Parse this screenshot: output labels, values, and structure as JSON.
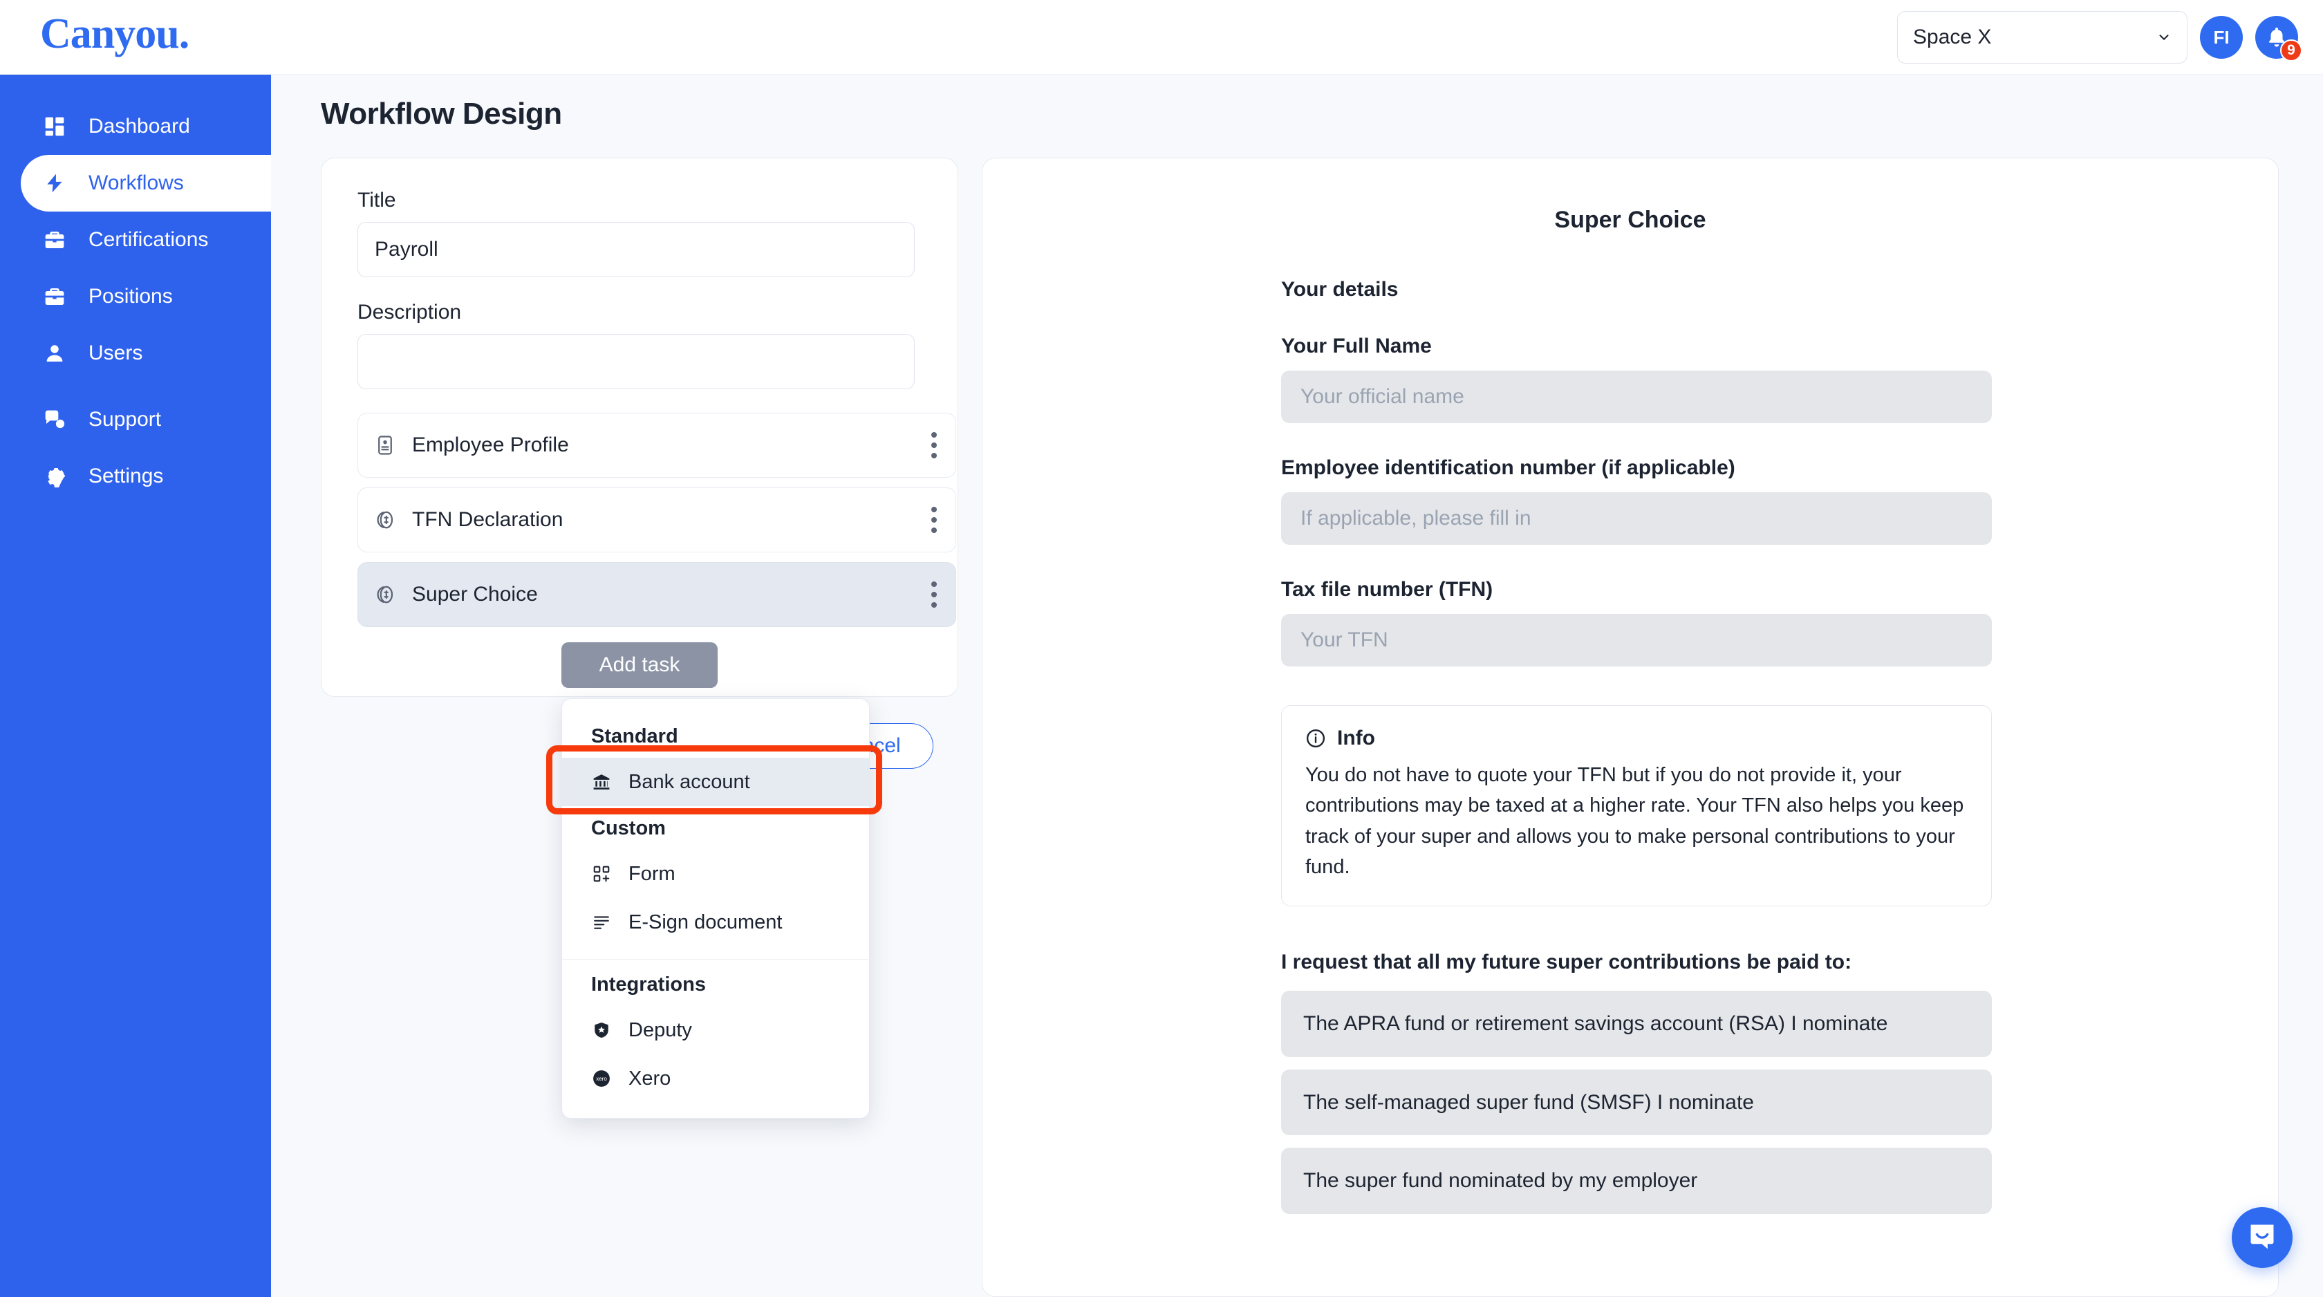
{
  "brand": {
    "logo_text": "Canyou.",
    "accent_color": "#2f6bf0",
    "sidebar_color": "#2f62ec"
  },
  "header": {
    "space_selector": {
      "value": "Space X",
      "icon": "chevron-down-icon"
    },
    "avatar_initials": "FI",
    "notification": {
      "icon": "bell-icon",
      "badge_count": "9",
      "badge_color": "#ef3a17"
    }
  },
  "sidebar": {
    "items": [
      {
        "label": "Dashboard",
        "icon": "dashboard-icon",
        "active": false
      },
      {
        "label": "Workflows",
        "icon": "lightning-icon",
        "active": true
      },
      {
        "label": "Certifications",
        "icon": "briefcase-icon",
        "active": false
      },
      {
        "label": "Positions",
        "icon": "briefcase-icon",
        "active": false
      },
      {
        "label": "Users",
        "icon": "user-icon",
        "active": false
      },
      {
        "label": "Support",
        "icon": "chat-question-icon",
        "active": false
      },
      {
        "label": "Settings",
        "icon": "gear-icon",
        "active": false
      }
    ]
  },
  "page": {
    "title": "Workflow Design"
  },
  "workflow_card": {
    "title_label": "Title",
    "title_value": "Payroll",
    "description_label": "Description",
    "description_value": "",
    "tasks": [
      {
        "label": "Employee Profile",
        "icon": "id-card-icon",
        "selected": false
      },
      {
        "label": "TFN Declaration",
        "icon": "coin-icon",
        "selected": false
      },
      {
        "label": "Super Choice",
        "icon": "coin-icon",
        "selected": true
      }
    ],
    "add_task_label": "Add task",
    "cancel_label": "Cancel"
  },
  "add_task_menu": {
    "groups": [
      {
        "heading": "Standard",
        "items": [
          {
            "label": "Bank account",
            "icon": "bank-icon",
            "highlighted": true
          }
        ]
      },
      {
        "heading": "Custom",
        "items": [
          {
            "label": "Form",
            "icon": "form-grid-icon",
            "highlighted": false
          },
          {
            "label": "E-Sign document",
            "icon": "document-lines-icon",
            "highlighted": false
          }
        ]
      },
      {
        "heading": "Integrations",
        "items": [
          {
            "label": "Deputy",
            "icon": "deputy-shield-icon",
            "highlighted": false
          },
          {
            "label": "Xero",
            "icon": "xero-icon",
            "highlighted": false
          }
        ]
      }
    ],
    "annotation_color": "#f73a0c"
  },
  "preview": {
    "title": "Super Choice",
    "section_heading": "Your details",
    "fields": [
      {
        "label": "Your Full Name",
        "placeholder": "Your official name",
        "value": ""
      },
      {
        "label": "Employee identification number (if applicable)",
        "placeholder": "If applicable, please fill in",
        "value": ""
      },
      {
        "label": "Tax file number (TFN)",
        "placeholder": "Your TFN",
        "value": ""
      }
    ],
    "info": {
      "icon": "info-icon",
      "heading": "Info",
      "text": "You do not have to quote your TFN but if you do not provide it, your contributions may be taxed at a higher rate. Your TFN also helps you keep track of your super and allows you to make personal contributions to your fund."
    },
    "choice_heading": "I request that all my future super contributions be paid to:",
    "choices": [
      "The APRA fund or retirement savings account (RSA) I nominate",
      "The self-managed super fund (SMSF) I nominate",
      "The super fund nominated by my employer"
    ]
  },
  "chat_launcher": {
    "icon": "chat-smile-icon"
  }
}
